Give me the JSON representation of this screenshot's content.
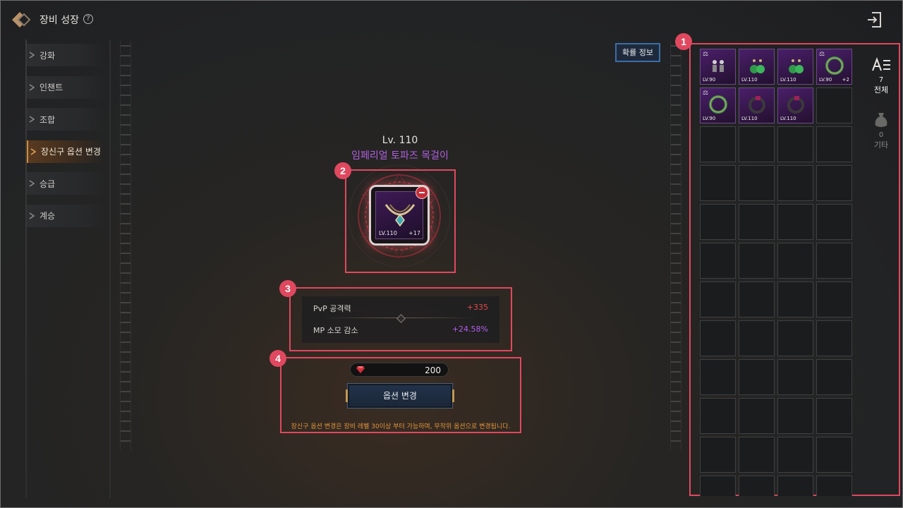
{
  "header": {
    "title": "장비 성장",
    "help_icon": "?"
  },
  "menu": {
    "items": [
      {
        "label": "강화",
        "active": false
      },
      {
        "label": "인챈트",
        "active": false
      },
      {
        "label": "조합",
        "active": false
      },
      {
        "label": "장신구 옵션 변경",
        "active": true
      },
      {
        "label": "승급",
        "active": false
      },
      {
        "label": "계승",
        "active": false
      }
    ]
  },
  "probability_button": "확률 정보",
  "item": {
    "level": "Lv. 110",
    "name": "임페리얼 토파즈 목걸이",
    "slot_level": "LV.110",
    "slot_plus": "+17"
  },
  "stats": [
    {
      "label": "PvP 공격력",
      "value": "+335",
      "color": "#e04a4a"
    },
    {
      "label": "MP 소모 감소",
      "value": "+24.58%",
      "color": "#b35ef0"
    }
  ],
  "cost": {
    "amount": "200",
    "icon": "red-gem-icon"
  },
  "action": {
    "button_label": "옵션 변경",
    "notice": "장신구 옵션 변경은 장비 레벨 30이상 부터 가능하며, 무작위 옵션으로 변경됩니다."
  },
  "badges": [
    "1",
    "2",
    "3",
    "4"
  ],
  "inventory": {
    "items": [
      {
        "level": "LV.90",
        "plus": "",
        "locked": true,
        "icon": "earring-icon"
      },
      {
        "level": "LV.110",
        "plus": "",
        "locked": false,
        "icon": "green-earring-icon"
      },
      {
        "level": "LV.110",
        "plus": "",
        "locked": false,
        "icon": "green-earring-icon"
      },
      {
        "level": "LV.90",
        "plus": "+2",
        "locked": true,
        "icon": "green-ring-icon"
      },
      {
        "level": "LV.90",
        "plus": "",
        "locked": true,
        "icon": "green-ring-icon"
      },
      {
        "level": "LV.110",
        "plus": "",
        "locked": false,
        "icon": "dark-ring-icon"
      },
      {
        "level": "LV.110",
        "plus": "",
        "locked": false,
        "icon": "dark-ring-icon"
      }
    ],
    "lock_glyph": "⚖",
    "tabs": [
      {
        "count": "7",
        "label": "전체",
        "icon": "list-sort-icon"
      },
      {
        "count": "0",
        "label": "기타",
        "icon": "pouch-icon"
      }
    ]
  },
  "colors": {
    "highlight": "#e0485f",
    "item_name": "#b15ee0",
    "notice": "#e2943a"
  }
}
